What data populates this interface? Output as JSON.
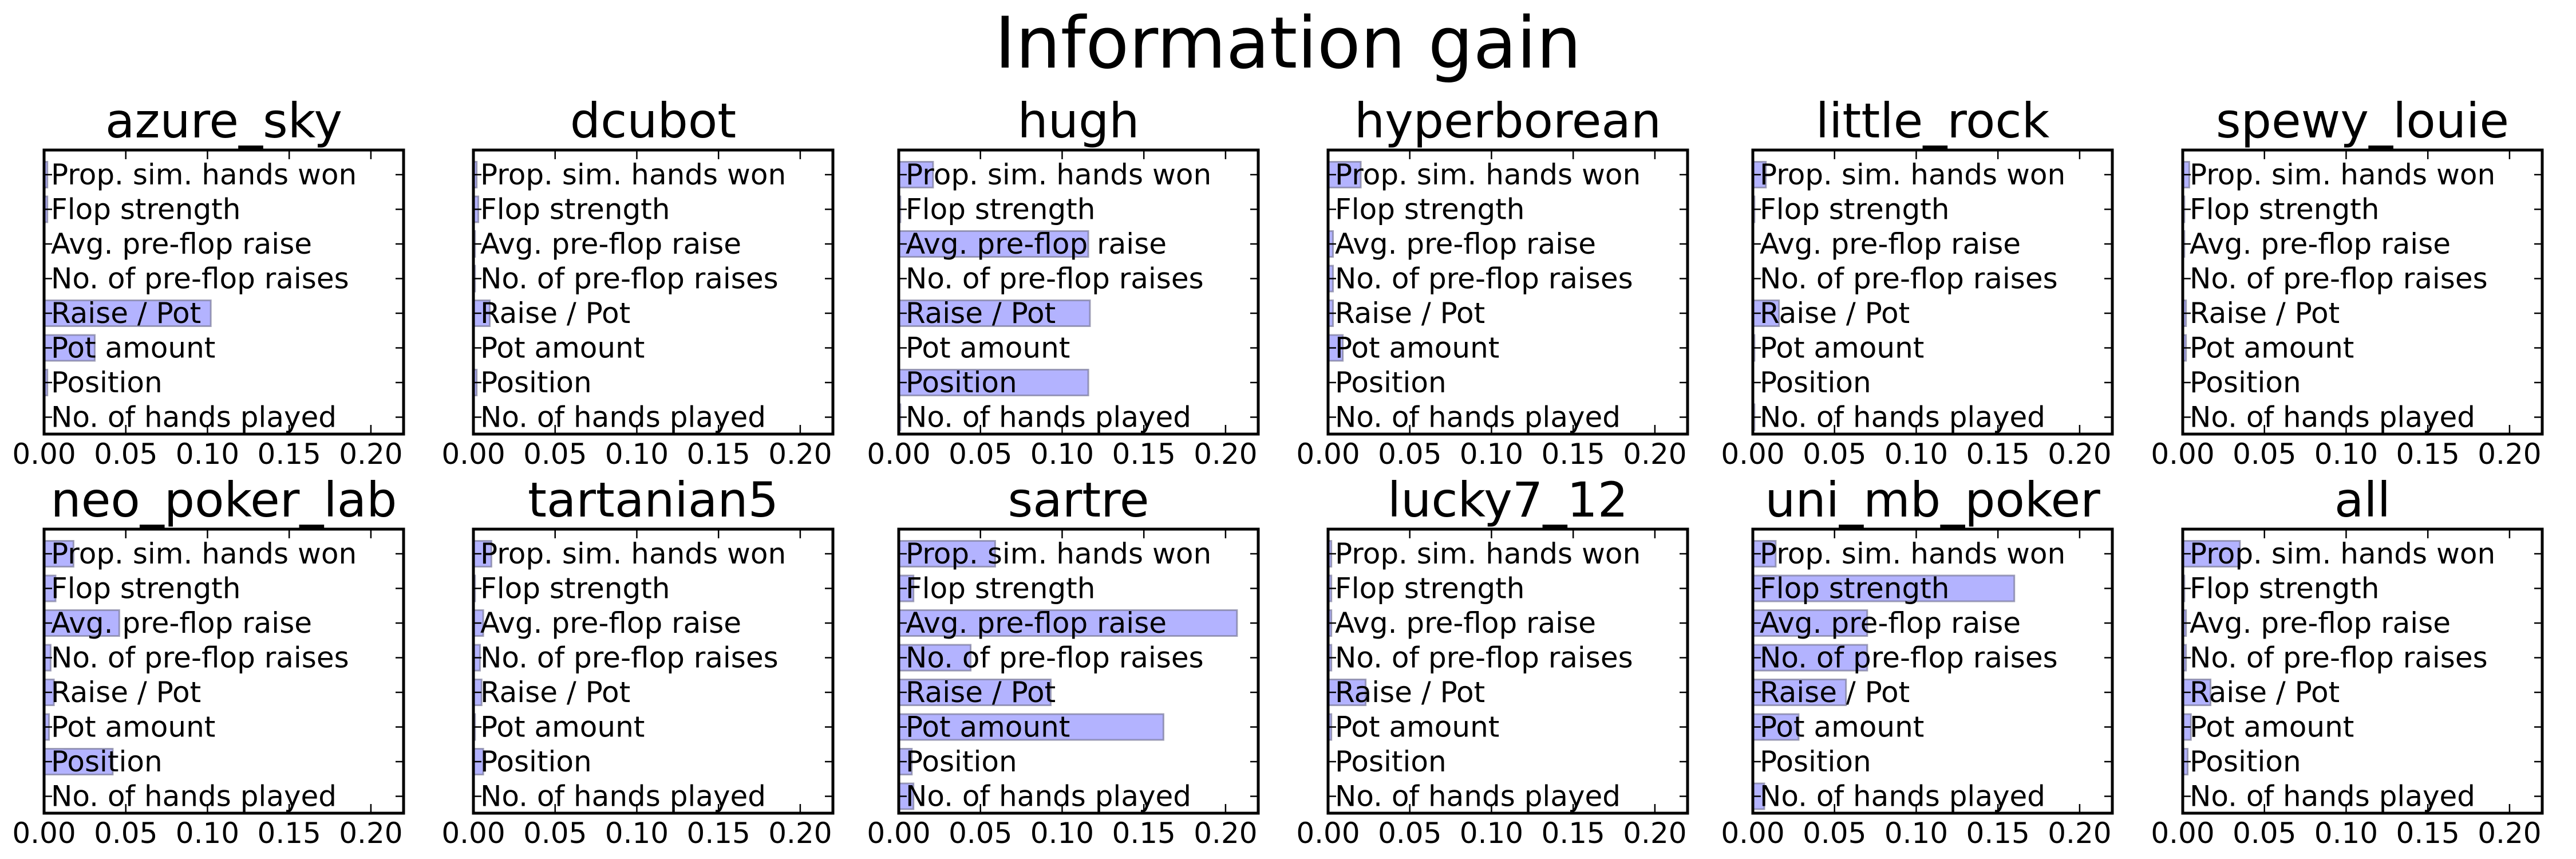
{
  "chart_data": {
    "type": "bar",
    "orientation": "horizontal",
    "title": "Information gain",
    "categories": [
      "Prop. sim. hands won",
      "Flop strength",
      "Avg. pre-flop raise",
      "No. of pre-flop raises",
      "Raise / Pot",
      "Pot amount",
      "Position",
      "No. of hands played"
    ],
    "xlim": [
      0,
      0.22
    ],
    "xticks": [
      "0.00",
      "0.05",
      "0.10",
      "0.15",
      "0.20"
    ],
    "grid": false,
    "bar_color": "#b3b3ff",
    "bar_edge_color": "#7a7a9a",
    "panels": [
      {
        "title": "azure_sky",
        "values": [
          0.002,
          0.002,
          0.0,
          0.0,
          0.102,
          0.031,
          0.002,
          0.0
        ]
      },
      {
        "title": "dcubot",
        "values": [
          0.002,
          0.003,
          0.001,
          0.001,
          0.01,
          0.0,
          0.002,
          0.0
        ]
      },
      {
        "title": "hugh",
        "values": [
          0.021,
          0.001,
          0.116,
          0.0,
          0.117,
          0.0,
          0.116,
          0.001
        ]
      },
      {
        "title": "hyperborean",
        "values": [
          0.02,
          0.0,
          0.003,
          0.003,
          0.003,
          0.009,
          0.0,
          0.0
        ]
      },
      {
        "title": "little_rock",
        "values": [
          0.008,
          0.001,
          0.0,
          0.0,
          0.016,
          0.001,
          0.0,
          0.001
        ]
      },
      {
        "title": "spewy_louie",
        "values": [
          0.004,
          0.001,
          0.001,
          0.0,
          0.002,
          0.002,
          0.0,
          0.0
        ]
      },
      {
        "title": "neo_poker_lab",
        "values": [
          0.018,
          0.007,
          0.046,
          0.004,
          0.006,
          0.003,
          0.042,
          0.0
        ]
      },
      {
        "title": "tartanian5",
        "values": [
          0.011,
          0.001,
          0.006,
          0.004,
          0.005,
          0.001,
          0.006,
          0.0
        ]
      },
      {
        "title": "sartre",
        "values": [
          0.059,
          0.009,
          0.207,
          0.044,
          0.093,
          0.162,
          0.008,
          0.009
        ]
      },
      {
        "title": "lucky7_12",
        "values": [
          0.002,
          0.002,
          0.002,
          0.002,
          0.023,
          0.002,
          0.0,
          0.0
        ]
      },
      {
        "title": "uni_mb_poker",
        "values": [
          0.014,
          0.16,
          0.07,
          0.07,
          0.057,
          0.028,
          0.0,
          0.007
        ]
      },
      {
        "title": "all",
        "values": [
          0.035,
          0.001,
          0.002,
          0.002,
          0.017,
          0.005,
          0.003,
          0.0
        ]
      }
    ]
  }
}
